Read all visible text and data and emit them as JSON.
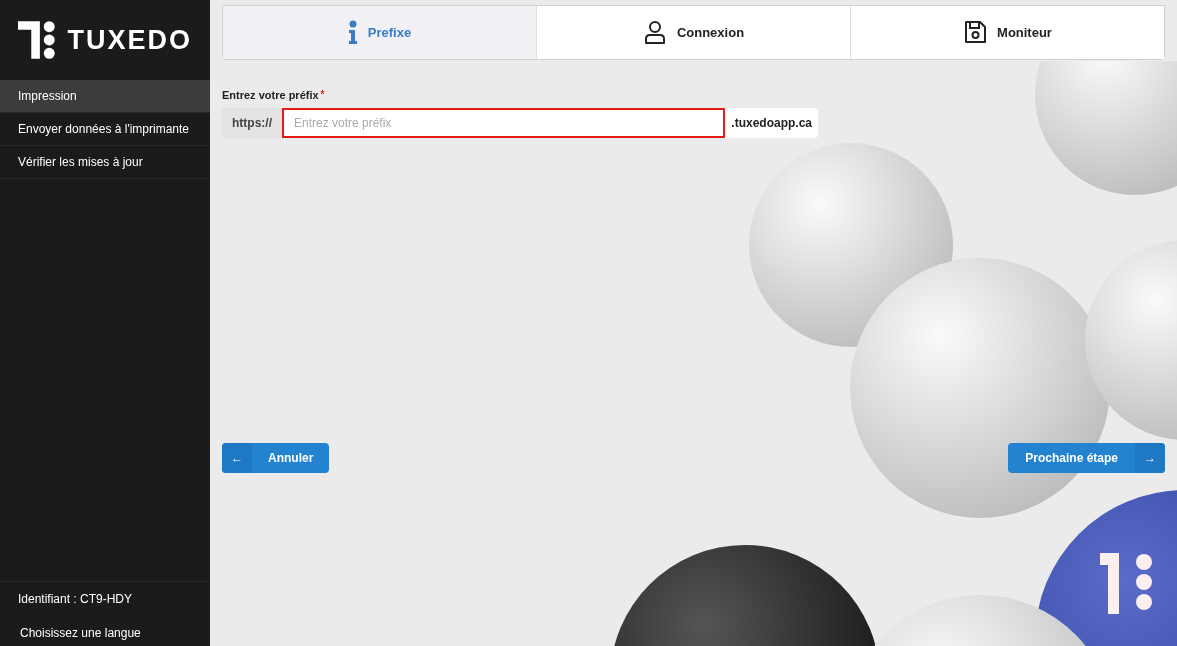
{
  "sidebar": {
    "brand": "TUXEDO",
    "items": [
      {
        "label": "Impression",
        "selected": true
      },
      {
        "label": "Envoyer données à l'imprimante",
        "selected": false
      },
      {
        "label": "Vérifier les mises à jour",
        "selected": false
      }
    ],
    "identifier": "Identifiant : CT9-HDY",
    "language": "Choisissez une langue"
  },
  "steps": [
    {
      "label": "Prefixe",
      "kind": "info",
      "selected": true
    },
    {
      "label": "Connexion",
      "kind": "user",
      "selected": false
    },
    {
      "label": "Moniteur",
      "kind": "save",
      "selected": false
    }
  ],
  "form": {
    "label": "Entrez votre préfix",
    "required_mark": "*",
    "prefix": "https://",
    "placeholder": "Entrez votre préfix",
    "suffix": ".tuxedoapp.ca"
  },
  "buttons": {
    "back": {
      "label": "Annuler",
      "icon": "←"
    },
    "next": {
      "label": "Prochaine étape",
      "icon": "→"
    }
  }
}
